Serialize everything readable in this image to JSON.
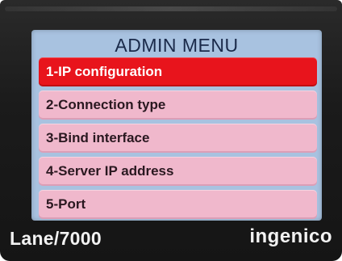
{
  "screen": {
    "title": "ADMIN MENU",
    "menu_items": [
      {
        "label": "1-IP configuration",
        "selected": true
      },
      {
        "label": "2-Connection type",
        "selected": false
      },
      {
        "label": "3-Bind interface",
        "selected": false
      },
      {
        "label": "4-Server IP address",
        "selected": false
      },
      {
        "label": "5-Port",
        "selected": false
      }
    ]
  },
  "device": {
    "model": "Lane/7000",
    "brand": "ingenico"
  },
  "colors": {
    "selected_item": "#e8141c",
    "menu_item": "#f0b8cc",
    "screen_background": "#a8c2e0",
    "device_body": "#1b1b1b"
  }
}
